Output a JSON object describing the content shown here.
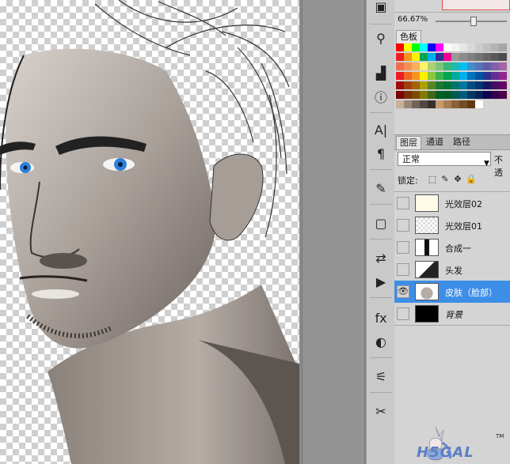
{
  "navigator": {
    "zoom": "66.67%"
  },
  "swatches_panel": {
    "tab_label": "色板",
    "colors": [
      [
        "#ff0000",
        "#ffff00",
        "#00ff00",
        "#00ffff",
        "#0000ff",
        "#ff00ff",
        "#ffffff",
        "#f2f2f2",
        "#e6e6e6",
        "#d9d9d9",
        "#cccccc",
        "#bfbfbf",
        "#b3b3b3",
        "#a6a6a6"
      ],
      [
        "#ee1d24",
        "#f7941d",
        "#fff200",
        "#00a651",
        "#00aeef",
        "#2e3192",
        "#ec008c",
        "#999999",
        "#8c8c8c",
        "#808080",
        "#737373",
        "#666666",
        "#595959",
        "#4d4d4d"
      ],
      [
        "#f26c4f",
        "#f68e55",
        "#fbaf5c",
        "#fff467",
        "#acd372",
        "#7cc576",
        "#3bb878",
        "#1abbb4",
        "#00bff3",
        "#438ccb",
        "#5574b9",
        "#605ca8",
        "#855fa8",
        "#a763a8"
      ],
      [
        "#ed1c24",
        "#f26522",
        "#f7941d",
        "#fff200",
        "#8dc63f",
        "#39b54a",
        "#00a651",
        "#00a99d",
        "#00aeef",
        "#0072bc",
        "#0054a6",
        "#2e3192",
        "#662d91",
        "#92278f"
      ],
      [
        "#9e0b0f",
        "#a0410d",
        "#a36209",
        "#aba000",
        "#598527",
        "#1a7b30",
        "#007236",
        "#00746b",
        "#0076a3",
        "#004b80",
        "#003471",
        "#1b1464",
        "#440e62",
        "#630460"
      ],
      [
        "#790000",
        "#7b2e00",
        "#7d4900",
        "#827b00",
        "#406618",
        "#005e20",
        "#005826",
        "#005952",
        "#005b7f",
        "#003663",
        "#002157",
        "#0d004c",
        "#32004b",
        "#4b0049"
      ],
      [
        "#c7b299",
        "#998675",
        "#736357",
        "#534741",
        "#37302d",
        "#c69c6d",
        "#a67c52",
        "#8c6239",
        "#754c24",
        "#603913",
        "#ffffff"
      ]
    ]
  },
  "layers_panel": {
    "tabs": [
      {
        "label": "图层",
        "active": true
      },
      {
        "label": "通道",
        "active": false
      },
      {
        "label": "路径",
        "active": false
      }
    ],
    "blend_mode": "正常",
    "opacity_label": "不透",
    "lock_label": "锁定:",
    "layers": [
      {
        "name": "光效层02",
        "visible": false,
        "selected": false
      },
      {
        "name": "光效层01",
        "visible": false,
        "selected": false
      },
      {
        "name": "合成一",
        "visible": false,
        "selected": false
      },
      {
        "name": "头发",
        "visible": false,
        "selected": false
      },
      {
        "name": "皮肤（脸部）",
        "visible": true,
        "selected": true
      },
      {
        "name": "背景",
        "visible": false,
        "selected": false
      }
    ]
  },
  "watermark": {
    "text": "H5GAL",
    "tm": "TM"
  },
  "tools": [
    "move-icon",
    "histogram-icon",
    "info-icon",
    "character-icon",
    "paragraph-icon",
    "brushes-icon",
    "layer-comps-icon",
    "clone-source-icon",
    "actions-icon",
    "styles-icon",
    "adjustments-icon",
    "tool-presets-icon",
    "masks-icon"
  ]
}
